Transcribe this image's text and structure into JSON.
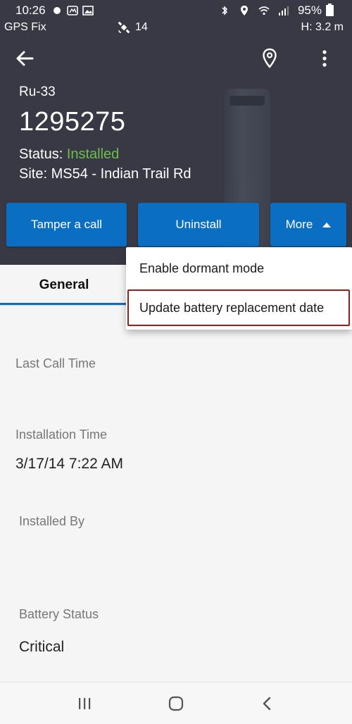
{
  "status_bar": {
    "time": "10:26",
    "battery_percent": "95%"
  },
  "gps_bar": {
    "fix_label": "GPS Fix",
    "satellites": "14",
    "height": "H: 3.2 m"
  },
  "toolbar": {
    "back_icon": "arrow-left-icon",
    "location_icon": "map-pin-icon",
    "overflow_icon": "more-vert-icon"
  },
  "device": {
    "model": "Ru-33",
    "serial": "1295275",
    "status_label": "Status: ",
    "status_value": "Installed",
    "site": "Site: MS54 - Indian Trail Rd"
  },
  "actions": {
    "tamper_label": "Tamper a call",
    "uninstall_label": "Uninstall",
    "more_label": "More"
  },
  "dropdown": {
    "items": [
      {
        "label": "Enable dormant mode"
      },
      {
        "label": "Update battery replacement date"
      }
    ]
  },
  "tabs": {
    "general_label": "General"
  },
  "fields": {
    "last_call_time_label": "Last Call Time",
    "last_call_time_value": "",
    "installation_time_label": "Installation Time",
    "installation_time_value": "3/17/14 7:22 AM",
    "installed_by_label": "Installed By",
    "installed_by_value": "",
    "battery_status_label": "Battery Status",
    "battery_status_value": "Critical"
  },
  "colors": {
    "header_bg": "#383944",
    "accent": "#0a6fc2",
    "status_installed": "#6cc04a",
    "highlight": "#a01a1a"
  }
}
